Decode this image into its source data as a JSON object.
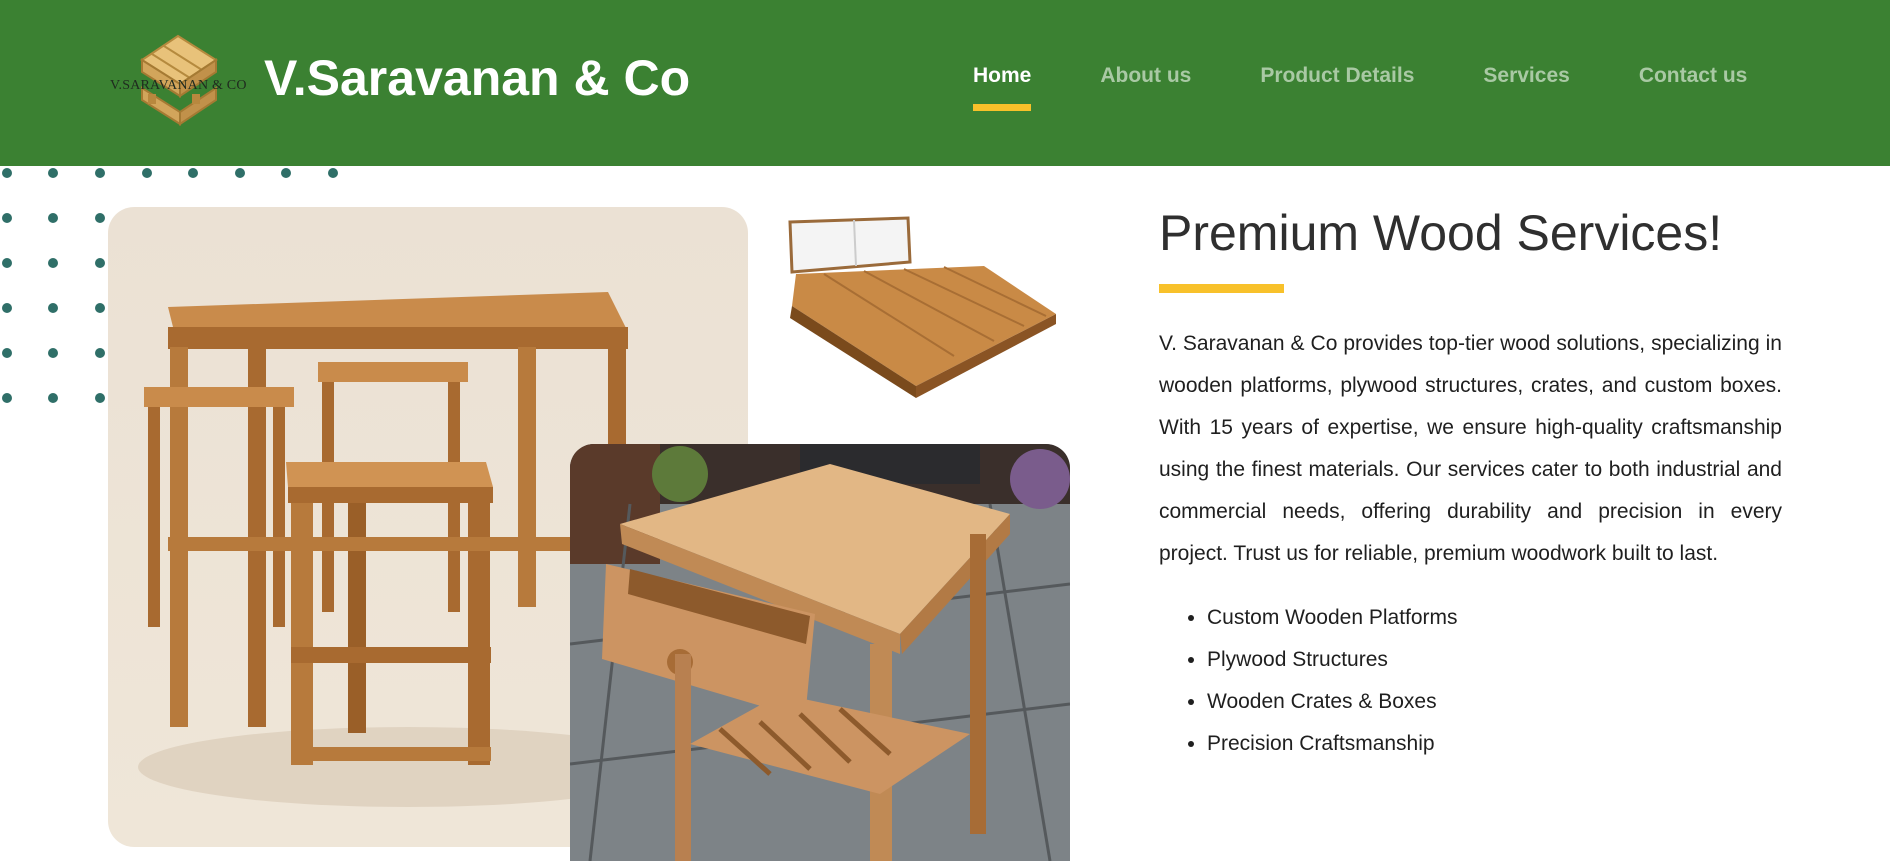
{
  "header": {
    "logo_text": "V.SARAVANAN & CO",
    "site_title": "V.Saravanan & Co",
    "nav": [
      {
        "label": "Home",
        "active": true
      },
      {
        "label": "About us",
        "active": false
      },
      {
        "label": "Product Details",
        "active": false
      },
      {
        "label": "Services",
        "active": false
      },
      {
        "label": "Contact us",
        "active": false
      }
    ]
  },
  "main": {
    "heading": "Premium Wood Services!",
    "paragraph": "V. Saravanan & Co provides top-tier wood solutions, specializing in wooden platforms, plywood structures, crates, and custom boxes. With 15 years of expertise, we ensure high-quality craftsmanship using the finest materials. Our services cater to both industrial and commercial needs, offering durability and precision in every project. Trust us for reliable, premium woodwork built to last.",
    "features": [
      "Custom Wooden Platforms",
      "Plywood Structures",
      "Wooden Crates & Boxes",
      "Precision Craftsmanship"
    ]
  },
  "images": [
    {
      "name": "bar-table-and-stools-photo"
    },
    {
      "name": "wooden-bed-platform-photo"
    },
    {
      "name": "wooden-side-table-photo"
    }
  ],
  "colors": {
    "header_bg": "#3b8132",
    "accent": "#f8c12a",
    "nav_inactive": "#a9c9a4",
    "dots": "#2f6f68"
  }
}
